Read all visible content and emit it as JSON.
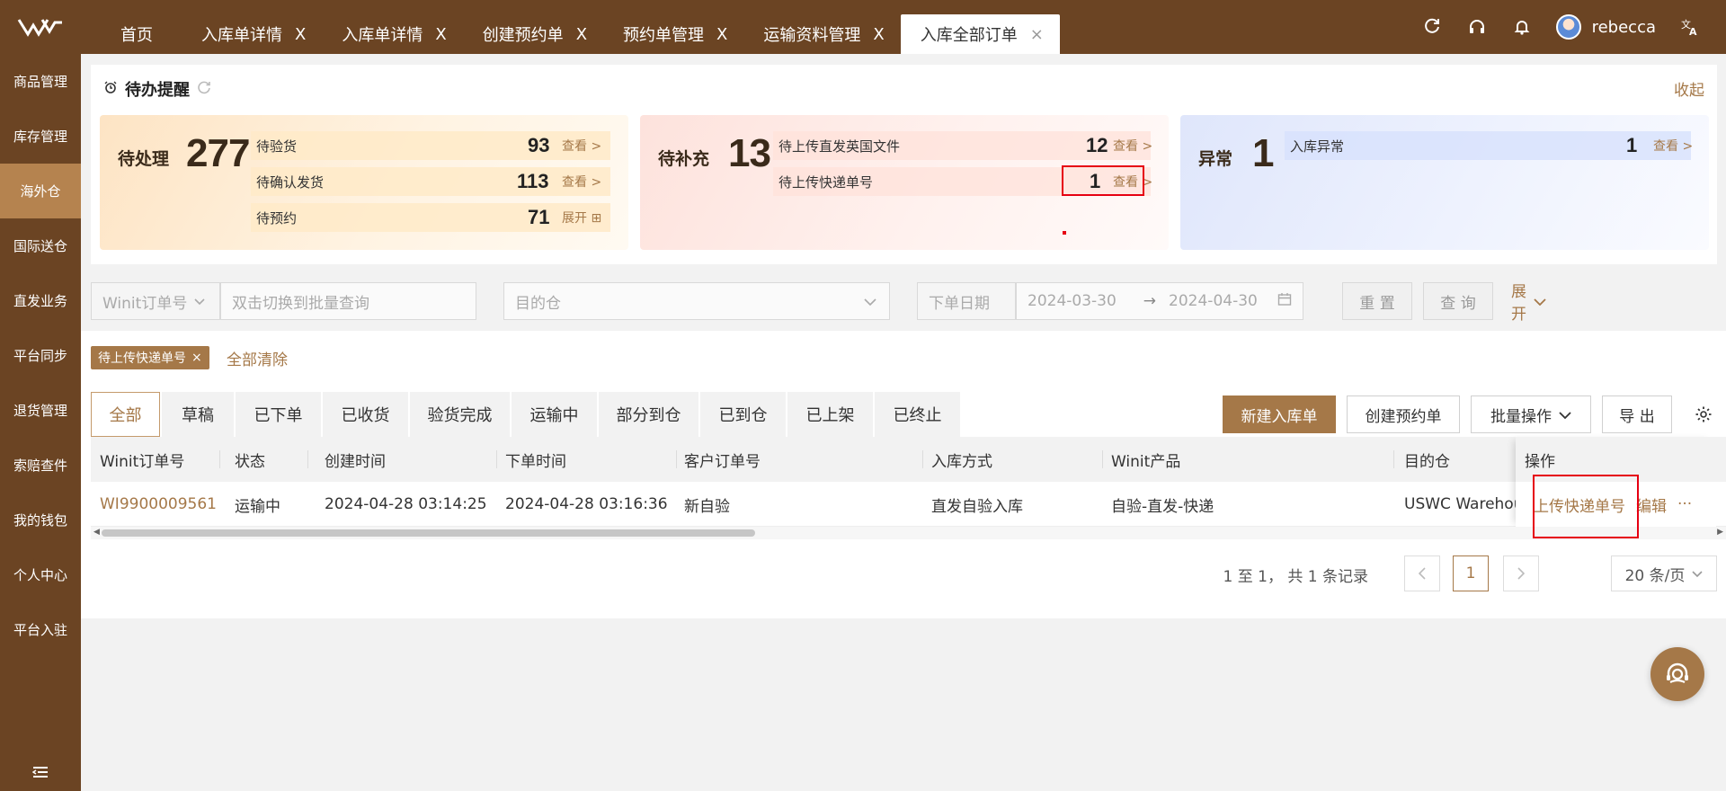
{
  "colors": {
    "brand": "#6b4423",
    "accent": "#a57848",
    "highlight_box": "#e60012"
  },
  "header": {
    "logo_icon": "winit-logo-icon",
    "tabs": [
      {
        "label": "首页"
      },
      {
        "label": "入库单详情",
        "close": "X"
      },
      {
        "label": "入库单详情",
        "close": "X"
      },
      {
        "label": "创建预约单",
        "close": "X"
      },
      {
        "label": "预约单管理",
        "close": "X"
      },
      {
        "label": "运输资料管理",
        "close": "X"
      },
      {
        "label": "入库全部订单",
        "close": "×"
      }
    ],
    "icons": [
      "refresh-icon",
      "headset-icon",
      "bell-icon",
      "translate-icon"
    ],
    "username": "rebecca"
  },
  "sidebar": {
    "items": [
      "商品管理",
      "库存管理",
      "海外仓",
      "国际送仓",
      "直发业务",
      "平台同步",
      "退货管理",
      "索赔查件",
      "我的钱包",
      "个人中心",
      "平台入驻"
    ],
    "active_index": 2
  },
  "reminder": {
    "title": "待办提醒",
    "collapse": "收起",
    "cards": [
      {
        "label": "待处理",
        "total": "277",
        "rows": [
          {
            "text": "待验货",
            "count": "93",
            "link": "查看 >"
          },
          {
            "text": "待确认发货",
            "count": "113",
            "link": "查看 >"
          },
          {
            "text": "待预约",
            "count": "71",
            "link": "展开 ⊞"
          }
        ]
      },
      {
        "label": "待补充",
        "total": "13",
        "rows": [
          {
            "text": "待上传直发英国文件",
            "count": "12",
            "link": "查看 >"
          },
          {
            "text": "待上传快递单号",
            "count": "1",
            "link": "查看 >"
          }
        ]
      },
      {
        "label": "异常",
        "total": "1",
        "rows": [
          {
            "text": "入库异常",
            "count": "1",
            "link": "查看 >"
          }
        ]
      }
    ]
  },
  "filters": {
    "order_type": "Winit订单号",
    "batch_placeholder": "双击切换到批量查询",
    "warehouse_placeholder": "目的仓",
    "date_label": "下单日期",
    "date_start": "2024-03-30",
    "date_arrow": "→",
    "date_end": "2024-04-30",
    "reset": "重 置",
    "query": "查 询",
    "expand": "展开"
  },
  "chips": {
    "active_filter": "待上传快递单号",
    "clear_all": "全部清除"
  },
  "status_tabs": [
    "全部",
    "草稿",
    "已下单",
    "已收货",
    "验货完成",
    "运输中",
    "部分到仓",
    "已到仓",
    "已上架",
    "已终止"
  ],
  "actions": {
    "new_inbound": "新建入库单",
    "create_booking": "创建预约单",
    "batch_ops": "批量操作",
    "export": "导 出"
  },
  "table": {
    "columns": [
      "Winit订单号",
      "状态",
      "创建时间",
      "下单时间",
      "客户订单号",
      "入库方式",
      "Winit产品",
      "目的仓",
      "操作"
    ],
    "rows": [
      {
        "order_no": "WI9900009561",
        "status": "运输中",
        "created": "2024-04-28 03:14:25",
        "ordered": "2024-04-28 03:16:36",
        "customer_no": "新自验",
        "inbound_method": "直发自验入库",
        "product": "自验-直发-快递",
        "warehouse": "USWC Warehou",
        "op_upload": "上传快递单号",
        "op_edit": "编辑",
        "op_more": "···"
      }
    ]
  },
  "pagination": {
    "summary": "1 至 1， 共 1 条记录",
    "current": "1",
    "page_size": "20 条/页"
  }
}
